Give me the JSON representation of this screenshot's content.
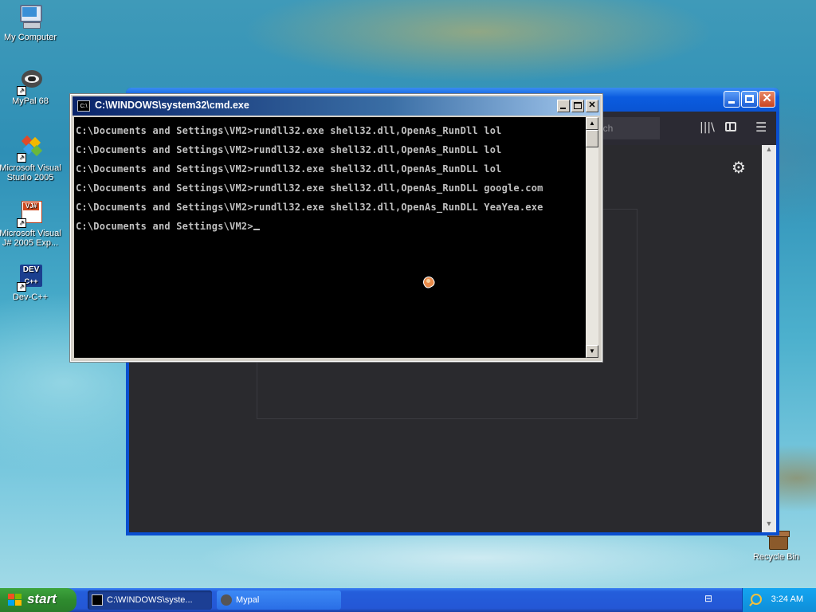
{
  "desktop": {
    "icons": [
      {
        "label": "My Computer",
        "icon": "my-computer-icon"
      },
      {
        "label": "MyPal 68",
        "icon": "mypal-icon"
      },
      {
        "label": "Microsoft Visual Studio 2005",
        "icon": "visual-studio-icon"
      },
      {
        "label": "Microsoft Visual J# 2005 Exp...",
        "icon": "visual-jsharp-icon"
      },
      {
        "label": "Dev-C++",
        "icon": "devcpp-icon"
      },
      {
        "label": "Recycle Bin",
        "icon": "recycle-bin-icon"
      }
    ]
  },
  "browser": {
    "search_placeholder": "arch",
    "icons": [
      "library-icon",
      "sidebar-icon",
      "menu-icon",
      "settings-gear-icon"
    ]
  },
  "cmd": {
    "title": "C:\\WINDOWS\\system32\\cmd.exe",
    "lines": [
      "C:\\Documents and Settings\\VM2>rundll32.exe shell32.dll,OpenAs_RunDll lol",
      "C:\\Documents and Settings\\VM2>rundll32.exe shell32.dll,OpenAs_RunDLL lol",
      "C:\\Documents and Settings\\VM2>rundll32.exe shell32.dll,OpenAs_RunDLL lol",
      "C:\\Documents and Settings\\VM2>rundll32.exe shell32.dll,OpenAs_RunDLL google.com",
      "C:\\Documents and Settings\\VM2>rundll32.exe shell32.dll,OpenAs_RunDLL YeaYea.exe"
    ],
    "prompt": "C:\\Documents and Settings\\VM2>"
  },
  "taskbar": {
    "start_label": "start",
    "tasks": [
      {
        "label": "C:\\WINDOWS\\syste...",
        "icon": "cmd-task-icon"
      },
      {
        "label": "Mypal",
        "icon": "mypal-task-icon"
      }
    ],
    "clock": "3:24 AM"
  }
}
